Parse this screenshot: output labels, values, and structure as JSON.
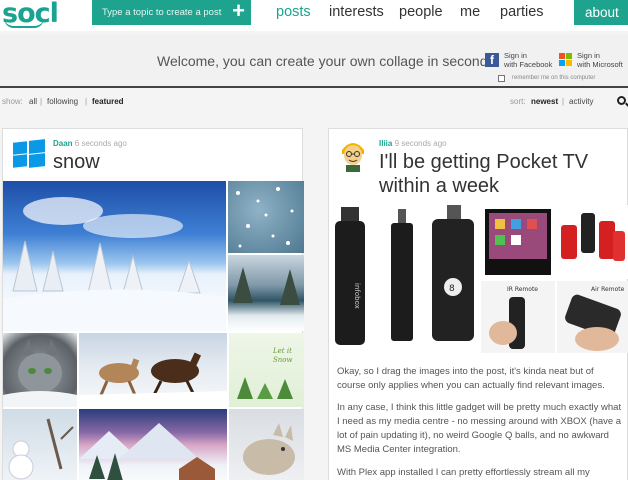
{
  "brand": {
    "logo": "socl"
  },
  "topbar": {
    "topic_placeholder": "Type a topic to create a post",
    "nav": [
      "posts",
      "interests",
      "people",
      "me",
      "parties"
    ],
    "about": "about"
  },
  "welcome": {
    "message": "Welcome, you can create your own collage in seconds",
    "facebook": {
      "line1": "Sign in",
      "line2": "with Facebook"
    },
    "microsoft": {
      "line1": "Sign in",
      "line2": "with Microsoft"
    },
    "remember": "remember me on this computer"
  },
  "filters": {
    "show_label": "show:",
    "show_options": [
      "all",
      "following",
      "featured"
    ],
    "sort_label": "sort:",
    "sort_options": [
      "newest",
      "activity"
    ]
  },
  "posts": [
    {
      "author": "Daan",
      "time": "6 seconds ago",
      "title": "snow"
    },
    {
      "author": "Iliia",
      "time": "9 seconds ago",
      "title_line1": "I'll be getting Pocket TV",
      "title_line2": "within a week",
      "image_labels": {
        "ir": "IR Remote",
        "air": "Air Remote",
        "brand": "infobox"
      },
      "body": [
        "Okay, so I drag the images into the post, it's kinda neat but of course only applies when you can actually find relevant images.",
        "In any case, I think this little gadget will be pretty much exactly what I need as my media centre - no messing around with XBOX (have a lot of pain updating it), no weird Google Q balls, and no awkward MS Media Center integration.",
        "With Plex app installed I can pretty effortlessly stream all my movies"
      ]
    }
  ],
  "colors": {
    "accent": "#1ea38e",
    "facebook": "#3b5998",
    "windows": "#0a99e6"
  }
}
